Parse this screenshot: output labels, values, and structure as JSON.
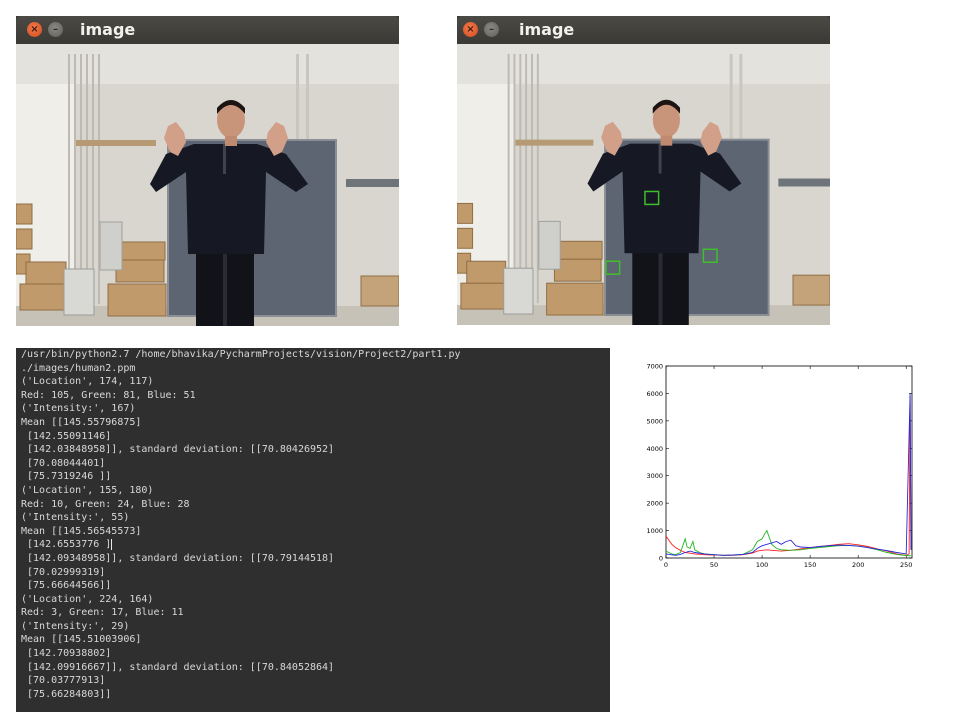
{
  "windows": [
    {
      "title": "image",
      "close_symbol": "×",
      "min_symbol": "–",
      "show_markers": false
    },
    {
      "title": "image",
      "close_symbol": "×",
      "min_symbol": "–",
      "show_markers": true
    }
  ],
  "marker_color": "#3fbf2a",
  "terminal": {
    "lines": [
      "/usr/bin/python2.7 /home/bhavika/PycharmProjects/vision/Project2/part1.py",
      "./images/human2.ppm",
      "('Location', 174, 117)",
      "Red: 105, Green: 81, Blue: 51",
      "('Intensity:', 167)",
      "Mean [[145.55796875]",
      " [142.55091146]",
      " [142.03848958]], standard deviation: [[70.80426952]",
      " [70.08044401]",
      " [75.7319246 ]]",
      "('Location', 155, 180)",
      "Red: 10, Green: 24, Blue: 28",
      "('Intensity:', 55)",
      "Mean [[145.56545573]",
      " [142.6553776 ]",
      " [142.09348958]], standard deviation: [[70.79144518]",
      " [70.02999319]",
      " [75.66644566]]",
      "('Location', 224, 164)",
      "Red: 3, Green: 17, Blue: 11",
      "('Intensity:', 29)",
      "Mean [[145.51003906]",
      " [142.70938802]",
      " [142.09916667]], standard deviation: [[70.84052864]",
      " [70.03777913]",
      " [75.66284803]]"
    ]
  },
  "chart_data": {
    "type": "line",
    "title": "",
    "xlabel": "",
    "ylabel": "",
    "xlim": [
      0,
      256
    ],
    "ylim": [
      0,
      7000
    ],
    "xticks": [
      "0",
      "50",
      "100",
      "150",
      "200",
      "250"
    ],
    "yticks": [
      "0",
      "1000",
      "2000",
      "3000",
      "4000",
      "5000",
      "6000",
      "7000"
    ],
    "grid": false,
    "series": [
      {
        "color": "#ff2020",
        "x": [
          0,
          3,
          6,
          10,
          15,
          20,
          30,
          40,
          50,
          60,
          70,
          80,
          90,
          95,
          100,
          105,
          110,
          120,
          130,
          140,
          150,
          160,
          170,
          180,
          190,
          200,
          210,
          220,
          230,
          240,
          250,
          253,
          254,
          255
        ],
        "y": [
          800,
          650,
          500,
          380,
          280,
          200,
          150,
          120,
          110,
          100,
          100,
          120,
          180,
          250,
          280,
          300,
          280,
          250,
          280,
          330,
          380,
          420,
          460,
          500,
          520,
          480,
          420,
          330,
          250,
          150,
          100,
          150,
          5900,
          300
        ]
      },
      {
        "color": "#22b622",
        "x": [
          0,
          3,
          6,
          10,
          15,
          18,
          20,
          22,
          25,
          28,
          30,
          35,
          40,
          50,
          60,
          70,
          80,
          90,
          95,
          100,
          103,
          105,
          108,
          110,
          115,
          120,
          130,
          140,
          150,
          160,
          170,
          180,
          190,
          200,
          210,
          220,
          230,
          240,
          250,
          255
        ],
        "y": [
          250,
          200,
          150,
          120,
          200,
          500,
          700,
          400,
          350,
          600,
          300,
          200,
          150,
          120,
          100,
          110,
          130,
          300,
          600,
          700,
          900,
          1000,
          700,
          500,
          350,
          300,
          280,
          300,
          350,
          380,
          420,
          450,
          460,
          440,
          380,
          300,
          200,
          130,
          90,
          80
        ]
      },
      {
        "color": "#2828e0",
        "x": [
          0,
          5,
          10,
          15,
          20,
          25,
          30,
          40,
          50,
          60,
          70,
          80,
          90,
          95,
          100,
          105,
          110,
          115,
          120,
          125,
          130,
          135,
          140,
          150,
          160,
          170,
          180,
          190,
          200,
          210,
          220,
          230,
          240,
          250,
          254,
          255
        ],
        "y": [
          150,
          120,
          100,
          130,
          200,
          250,
          200,
          150,
          120,
          100,
          110,
          130,
          200,
          350,
          450,
          500,
          550,
          600,
          500,
          600,
          650,
          450,
          400,
          380,
          420,
          450,
          470,
          460,
          430,
          380,
          320,
          270,
          200,
          150,
          6000,
          300
        ]
      }
    ]
  }
}
